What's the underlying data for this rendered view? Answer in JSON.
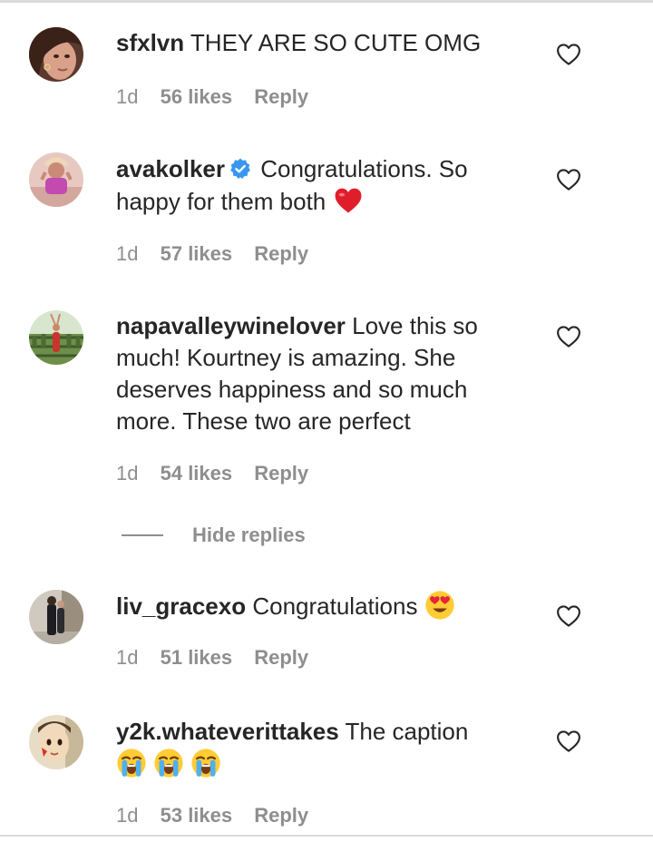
{
  "comments": [
    {
      "username": "sfxlvn",
      "text": "THEY ARE SO CUTE OMG",
      "time": "1d",
      "likes": "56 likes",
      "reply": "Reply"
    },
    {
      "username": "avakolker",
      "verified": true,
      "text": "Congratulations. So happy for them both",
      "emoji": "red-heart",
      "time": "1d",
      "likes": "57 likes",
      "reply": "Reply"
    },
    {
      "username": "napavalleywinelover",
      "text": "Love this so much! Kourtney is amazing. She deserves happiness and so much more. These two are perfect",
      "time": "1d",
      "likes": "54 likes",
      "reply": "Reply"
    },
    {
      "username": "liv_gracexo",
      "text": "Congratulations",
      "emoji": "heart-eyes-face",
      "time": "1d",
      "likes": "51 likes",
      "reply": "Reply"
    },
    {
      "username": "y2k.whateverittakes",
      "text": "The caption",
      "emoji": "loudly-crying-face x3",
      "time": "1d",
      "likes": "53 likes",
      "reply": "Reply"
    }
  ],
  "hide_replies_label": "Hide replies",
  "colors": {
    "text": "#262626",
    "muted": "#8e8e8e",
    "verified": "#3897f0",
    "divider": "#dbdbdb"
  }
}
